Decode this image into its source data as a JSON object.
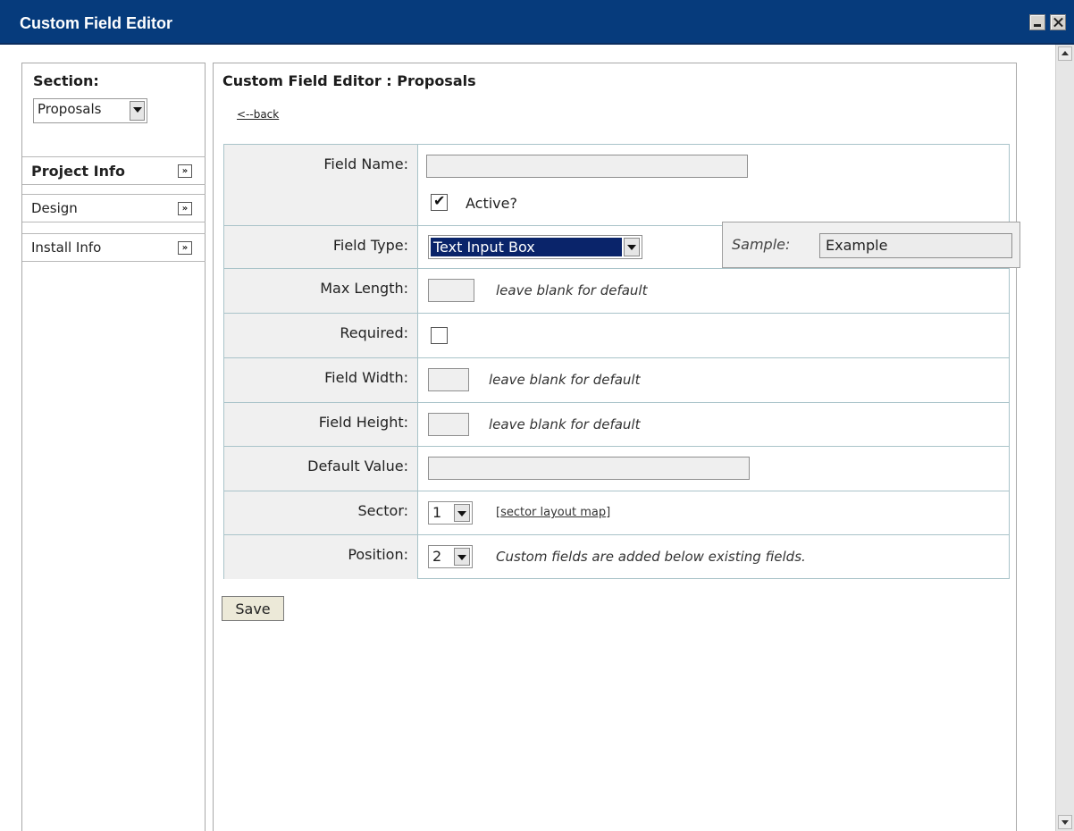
{
  "window": {
    "title": "Custom Field Editor",
    "min_icon": "minimize-icon",
    "close_icon": "close-icon"
  },
  "sidebar": {
    "section_label": "Section:",
    "section_value": "Proposals",
    "items": [
      {
        "label": "Project Info",
        "active": true
      },
      {
        "label": "Design",
        "active": false
      },
      {
        "label": "Install Info",
        "active": false
      }
    ],
    "chevron_glyph": "»"
  },
  "main": {
    "title": "Custom Field Editor : Proposals",
    "back_link": "<--back"
  },
  "form": {
    "field_name": {
      "label": "Field Name:",
      "value": "",
      "active_label": "Active?",
      "active_checked": true
    },
    "field_type": {
      "label": "Field Type:",
      "value": "Text Input Box",
      "sample_label": "Sample:",
      "sample_value": "Example"
    },
    "max_length": {
      "label": "Max Length:",
      "value": "",
      "hint": "leave blank for default"
    },
    "required": {
      "label": "Required:",
      "checked": false
    },
    "field_width": {
      "label": "Field Width:",
      "value": "",
      "hint": "leave blank for default"
    },
    "field_height": {
      "label": "Field Height:",
      "value": "",
      "hint": "leave blank for default"
    },
    "default_value": {
      "label": "Default Value:",
      "value": ""
    },
    "sector": {
      "label": "Sector:",
      "value": "1",
      "link_open": "[",
      "link_text": "sector layout map",
      "link_close": "]"
    },
    "position": {
      "label": "Position:",
      "value": "2",
      "hint": "Custom fields are added below existing fields."
    }
  },
  "actions": {
    "save_label": "Save"
  }
}
